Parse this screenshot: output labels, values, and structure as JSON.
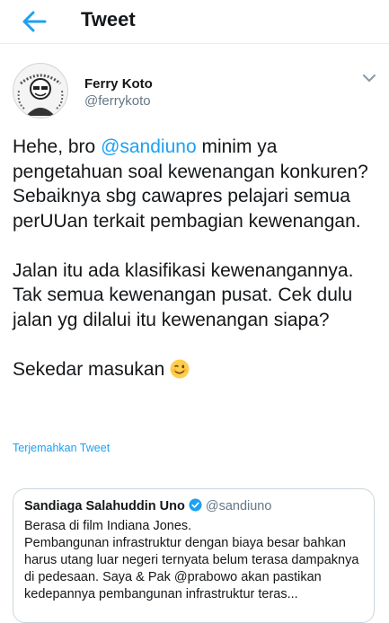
{
  "header": {
    "title": "Tweet"
  },
  "tweet": {
    "author_name": "Ferry Koto",
    "author_handle": "@ferrykoto",
    "text_part1": "Hehe, bro ",
    "mention": "@sandiuno",
    "text_part2": " minim ya pengetahuan soal kewenangan konkuren? Sebaiknya sbg cawapres pelajari semua perUUan terkait pembagian kewenangan.\n\nJalan itu ada klasifikasi kewenangannya. Tak semua kewenangan pusat. Cek dulu jalan yg dilalui itu kewenangan siapa?\n\nSekedar masukan",
    "translate_label": "Terjemahkan Tweet"
  },
  "quoted_tweet": {
    "author_name": "Sandiaga Salahuddin Uno",
    "author_handle": "@sandiuno",
    "text": "Berasa di film Indiana Jones.\nPembangunan infrastruktur dengan biaya besar bahkan harus utang luar negeri ternyata belum terasa dampaknya di pedesaan. Saya & Pak @prabowo akan pastikan kedepannya pembangunan infrastruktur teras..."
  },
  "colors": {
    "accent": "#1da1f2",
    "muted": "#657786",
    "text": "#14171a"
  }
}
